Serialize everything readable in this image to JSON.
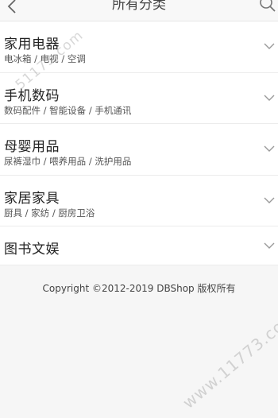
{
  "header": {
    "title": "所有分类",
    "back_icon": "chevron-left-icon",
    "search_icon": "search-icon"
  },
  "categories": [
    {
      "title": "家用电器",
      "sub": "电冰箱 / 电视 / 空调"
    },
    {
      "title": "手机数码",
      "sub": "数码配件 / 智能设备 / 手机通讯"
    },
    {
      "title": "母婴用品",
      "sub": "尿裤湿巾 / 喂养用品 / 洗护用品"
    },
    {
      "title": "家居家具",
      "sub": "厨具 / 家纺 / 厨房卫浴"
    },
    {
      "title": "图书文娱",
      "sub": ""
    }
  ],
  "footer": {
    "copyright": "Copyright ©2012-2019 DBShop 版权所有"
  },
  "watermark": {
    "top": "51173.com",
    "bottom": "www.11773.com"
  }
}
